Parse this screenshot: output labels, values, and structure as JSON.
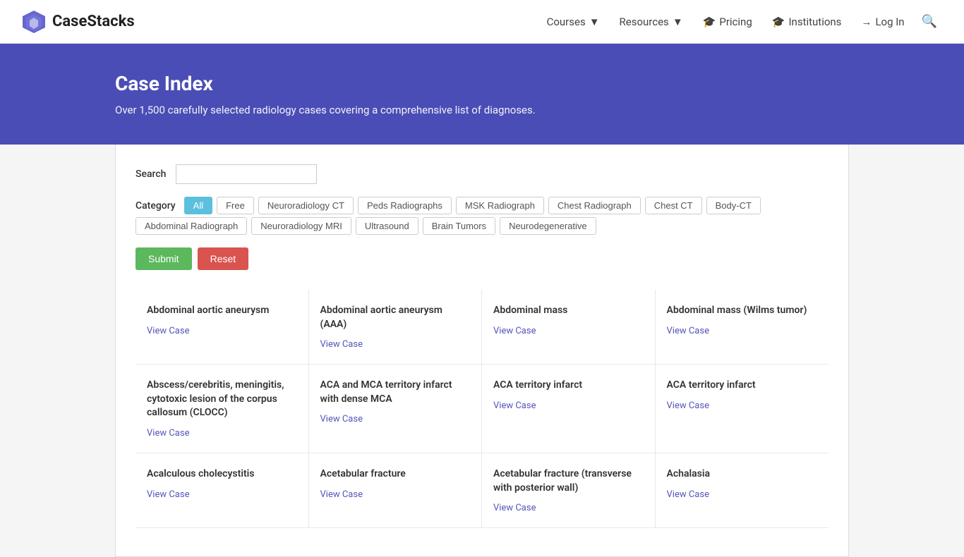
{
  "brand": {
    "name": "CaseStacks"
  },
  "nav": {
    "links": [
      {
        "label": "Courses",
        "icon": "▼",
        "hasDropdown": true
      },
      {
        "label": "Resources",
        "icon": "▼",
        "hasDropdown": true
      },
      {
        "label": "Pricing",
        "icon": "🎓",
        "hasIcon": true
      },
      {
        "label": "Institutions",
        "icon": "🎓",
        "hasIcon": true
      },
      {
        "label": "Log In",
        "icon": "→",
        "hasIcon": true
      }
    ]
  },
  "hero": {
    "title": "Case Index",
    "subtitle": "Over 1,500 carefully selected radiology cases covering a comprehensive list of diagnoses."
  },
  "search": {
    "label": "Search",
    "placeholder": ""
  },
  "category": {
    "label": "Category",
    "buttons": [
      {
        "label": "All",
        "active": true
      },
      {
        "label": "Free",
        "active": false
      },
      {
        "label": "Neuroradiology CT",
        "active": false
      },
      {
        "label": "Peds Radiographs",
        "active": false
      },
      {
        "label": "MSK Radiograph",
        "active": false
      },
      {
        "label": "Chest Radiograph",
        "active": false
      },
      {
        "label": "Chest CT",
        "active": false
      },
      {
        "label": "Body-CT",
        "active": false
      },
      {
        "label": "Abdominal Radiograph",
        "active": false
      },
      {
        "label": "Neuroradiology MRI",
        "active": false
      },
      {
        "label": "Ultrasound",
        "active": false
      },
      {
        "label": "Brain Tumors",
        "active": false
      },
      {
        "label": "Neurodegenerative",
        "active": false
      }
    ]
  },
  "buttons": {
    "submit": "Submit",
    "reset": "Reset"
  },
  "cases": [
    {
      "title": "Abdominal aortic aneurysm",
      "viewCase": "View Case"
    },
    {
      "title": "Abdominal aortic aneurysm (AAA)",
      "viewCase": "View Case"
    },
    {
      "title": "Abdominal mass",
      "viewCase": "View Case"
    },
    {
      "title": "Abdominal mass (Wilms tumor)",
      "viewCase": "View Case"
    },
    {
      "title": "Abscess/cerebritis, meningitis, cytotoxic lesion of the corpus callosum (CLOCC)",
      "viewCase": "View Case"
    },
    {
      "title": "ACA and MCA territory infarct with dense MCA",
      "viewCase": "View Case"
    },
    {
      "title": "ACA territory infarct",
      "viewCase": "View Case"
    },
    {
      "title": "ACA territory infarct",
      "viewCase": "View Case"
    },
    {
      "title": "Acalculous cholecystitis",
      "viewCase": "View Case"
    },
    {
      "title": "Acetabular fracture",
      "viewCase": "View Case"
    },
    {
      "title": "Acetabular fracture (transverse with posterior wall)",
      "viewCase": "View Case"
    },
    {
      "title": "Achalasia",
      "viewCase": "View Case"
    }
  ]
}
